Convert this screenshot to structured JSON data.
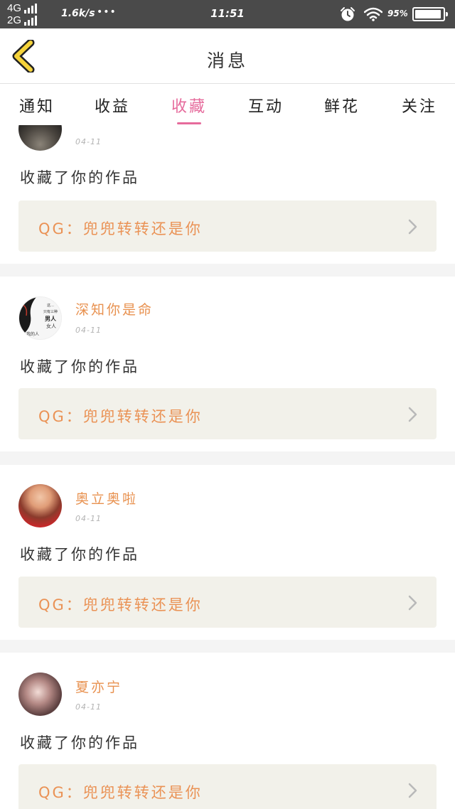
{
  "status_bar": {
    "net_top": "4G",
    "net_bottom": "2G",
    "speed": "1.6k/s",
    "dots": "•••",
    "time": "11:51",
    "battery_percent": "95%",
    "battery_level": 0.95
  },
  "header": {
    "title": "消息"
  },
  "tabs": [
    {
      "label": "通知"
    },
    {
      "label": "收益"
    },
    {
      "label": "收藏"
    },
    {
      "label": "互动"
    },
    {
      "label": "鲜花"
    },
    {
      "label": "关注"
    }
  ],
  "active_tab": "收藏",
  "avatar_overlay": {
    "l1": "这…",
    "l2": "只有三种",
    "l3": "男人",
    "l4": "女人",
    "l5": "我的人"
  },
  "items": [
    {
      "username": "",
      "date": "04-11",
      "action": "收藏了你的作品",
      "work": "QG：兜兜转转还是你"
    },
    {
      "username": "深知你是命",
      "date": "04-11",
      "action": "收藏了你的作品",
      "work": "QG：兜兜转转还是你"
    },
    {
      "username": "奥立奥啦",
      "date": "04-11",
      "action": "收藏了你的作品",
      "work": "QG：兜兜转转还是你"
    },
    {
      "username": "夏亦宁",
      "date": "04-11",
      "action": "收藏了你的作品",
      "work": "QG：兜兜转转还是你"
    }
  ],
  "colors": {
    "accent_pink": "#e66b9c",
    "username_orange": "#e8914f",
    "status_bar": "#4a4a4a",
    "work_box": "#f2f1ea"
  }
}
